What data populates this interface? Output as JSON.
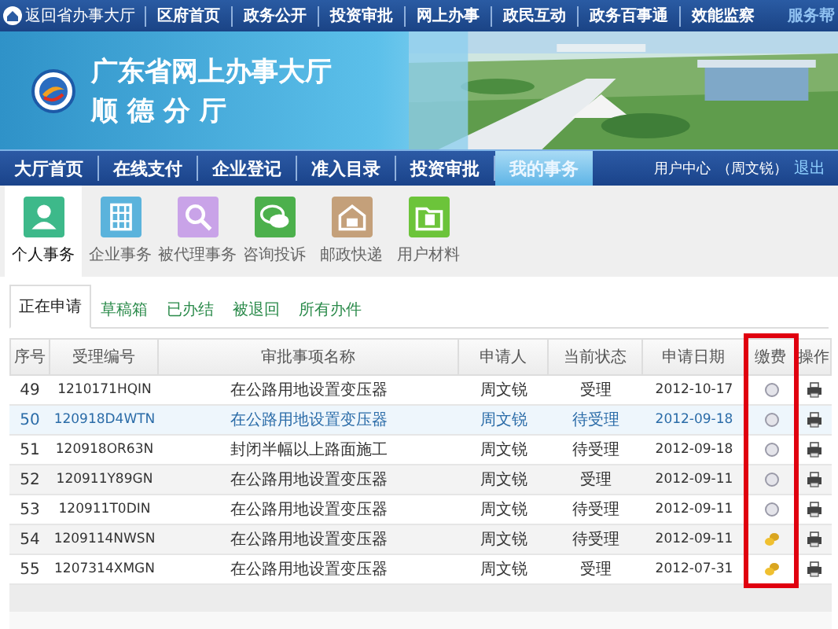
{
  "top_nav": {
    "home_link": "返回省办事大厅",
    "items": [
      "区府首页",
      "政务公开",
      "投资审批",
      "网上办事",
      "政民互动",
      "政务百事通",
      "效能监察"
    ],
    "help": "服务帮"
  },
  "banner": {
    "title": "广东省网上办事大厅",
    "subtitle": "顺 德 分 厅"
  },
  "main_nav": {
    "items": [
      {
        "label": "大厅首页",
        "selected": false
      },
      {
        "label": "在线支付",
        "selected": false
      },
      {
        "label": "企业登记",
        "selected": false
      },
      {
        "label": "准入目录",
        "selected": false
      },
      {
        "label": "投资审批",
        "selected": false
      },
      {
        "label": "我的事务",
        "selected": true
      }
    ],
    "user_center": "用户中心",
    "user_name": "（周文锐）",
    "logout": "退出"
  },
  "categories": [
    {
      "label": "个人事务",
      "selected": true
    },
    {
      "label": "企业事务",
      "selected": false
    },
    {
      "label": "被代理事务",
      "selected": false
    },
    {
      "label": "咨询投诉",
      "selected": false
    },
    {
      "label": "邮政快递",
      "selected": false
    },
    {
      "label": "用户材料",
      "selected": false
    }
  ],
  "tabs": [
    {
      "label": "正在申请",
      "selected": true
    },
    {
      "label": "草稿箱",
      "selected": false
    },
    {
      "label": "已办结",
      "selected": false
    },
    {
      "label": "被退回",
      "selected": false
    },
    {
      "label": "所有办件",
      "selected": false
    }
  ],
  "table": {
    "columns": [
      {
        "label": "序号",
        "highlighted": false
      },
      {
        "label": "受理编号",
        "highlighted": false
      },
      {
        "label": "审批事项名称",
        "highlighted": false
      },
      {
        "label": "申请人",
        "highlighted": false
      },
      {
        "label": "当前状态",
        "highlighted": false
      },
      {
        "label": "申请日期",
        "highlighted": false
      },
      {
        "label": "缴费",
        "highlighted": true
      },
      {
        "label": "操作",
        "highlighted": false
      }
    ],
    "rows": [
      {
        "no": "49",
        "code": "1210171HQIN",
        "name": "在公路用地设置变压器",
        "applicant": "周文锐",
        "status": "受理",
        "date": "2012-10-17",
        "paid": false,
        "selected": false
      },
      {
        "no": "50",
        "code": "120918D4WTN",
        "name": "在公路用地设置变压器",
        "applicant": "周文锐",
        "status": "待受理",
        "date": "2012-09-18",
        "paid": false,
        "selected": true
      },
      {
        "no": "51",
        "code": "120918OR63N",
        "name": "封闭半幅以上路面施工",
        "applicant": "周文锐",
        "status": "待受理",
        "date": "2012-09-18",
        "paid": false,
        "selected": false
      },
      {
        "no": "52",
        "code": "120911Y89GN",
        "name": "在公路用地设置变压器",
        "applicant": "周文锐",
        "status": "受理",
        "date": "2012-09-11",
        "paid": false,
        "selected": false
      },
      {
        "no": "53",
        "code": "120911T0DIN",
        "name": "在公路用地设置变压器",
        "applicant": "周文锐",
        "status": "待受理",
        "date": "2012-09-11",
        "paid": false,
        "selected": false
      },
      {
        "no": "54",
        "code": "1209114NWSN",
        "name": "在公路用地设置变压器",
        "applicant": "周文锐",
        "status": "待受理",
        "date": "2012-09-11",
        "paid": true,
        "selected": false
      },
      {
        "no": "55",
        "code": "1207314XMGN",
        "name": "在公路用地设置变压器",
        "applicant": "周文锐",
        "status": "受理",
        "date": "2012-07-31",
        "paid": true,
        "selected": false
      }
    ]
  }
}
